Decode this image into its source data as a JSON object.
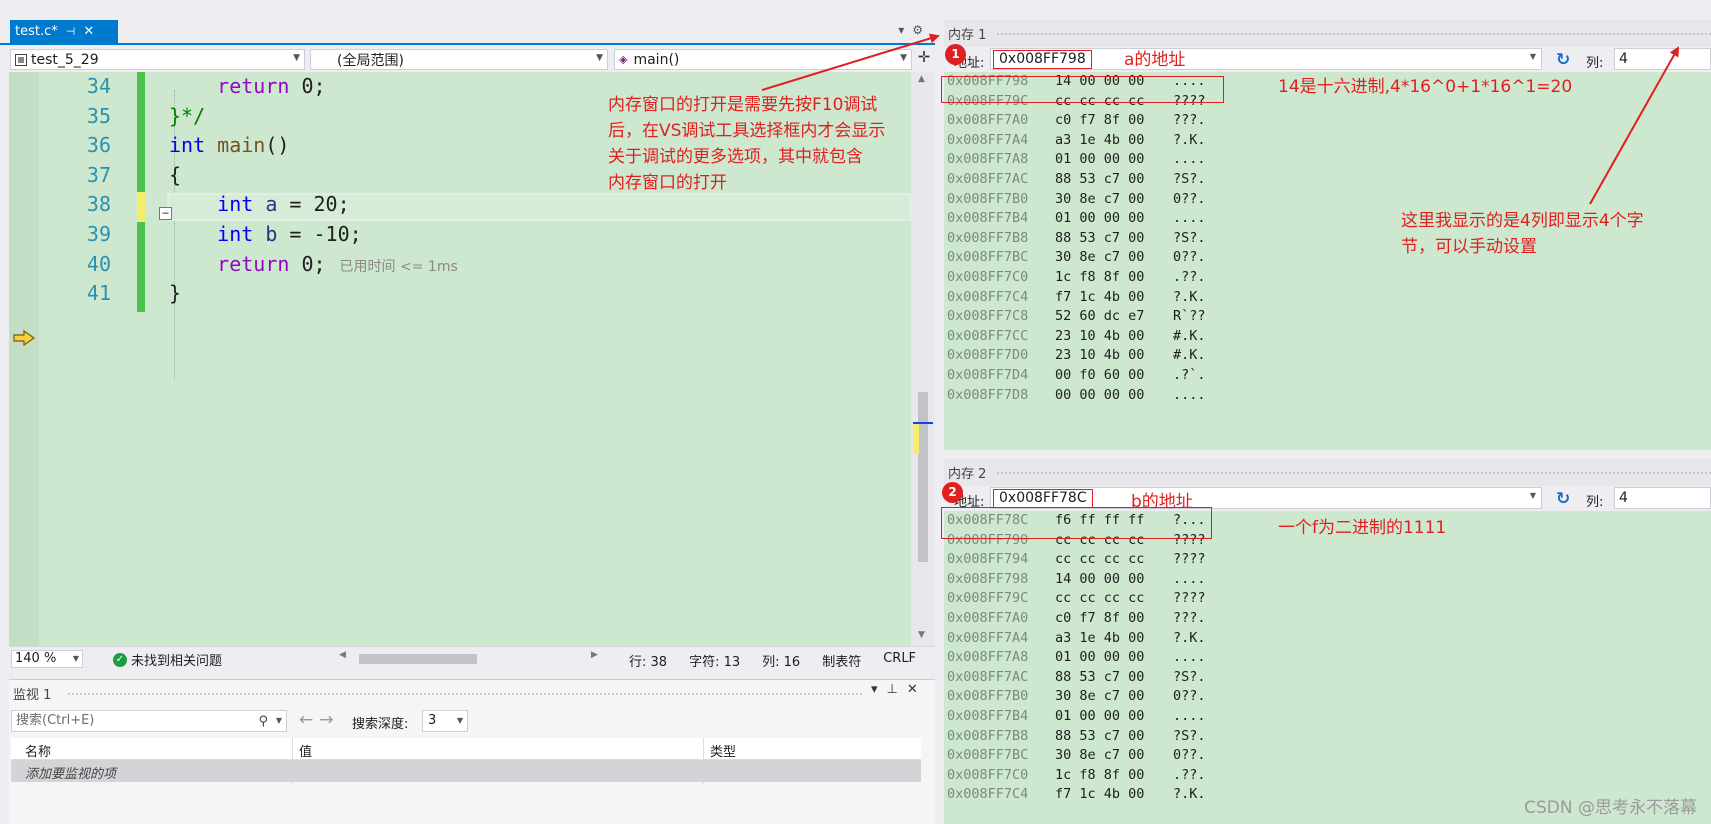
{
  "editor": {
    "tab": {
      "title": "test.c*"
    },
    "nav": {
      "project": "test_5_29",
      "scope": "(全局范围)",
      "function": "main()"
    },
    "line_numbers": [
      "34",
      "35",
      "36",
      "37",
      "38",
      "39",
      "40",
      "41"
    ],
    "elapsed": "已用时间 <= 1ms",
    "status": {
      "zoom": "140 %",
      "issues": "未找到相关问题",
      "line": "行: 38",
      "char": "字符: 13",
      "col": "列: 16",
      "tabs": "制表符",
      "eol": "CRLF"
    }
  },
  "watch": {
    "title": "监视 1",
    "search_placeholder": "搜索(Ctrl+E)",
    "depth_label": "搜索深度:",
    "depth_value": "3",
    "headers": [
      "名称",
      "值",
      "类型"
    ],
    "add_item": "添加要监视的项"
  },
  "memory1": {
    "title": "内存 1",
    "address_label": "地址:",
    "address_value": "0x008FF798",
    "columns_label": "列:",
    "columns_value": "4",
    "rows": [
      [
        "0x008FF798",
        "14 00 00 00",
        "...."
      ],
      [
        "0x008FF79C",
        "cc cc cc cc",
        "????"
      ],
      [
        "0x008FF7A0",
        "c0 f7 8f 00",
        "???."
      ],
      [
        "0x008FF7A4",
        "a3 1e 4b 00",
        "?.K."
      ],
      [
        "0x008FF7A8",
        "01 00 00 00",
        "...."
      ],
      [
        "0x008FF7AC",
        "88 53 c7 00",
        "?S?."
      ],
      [
        "0x008FF7B0",
        "30 8e c7 00",
        "0??."
      ],
      [
        "0x008FF7B4",
        "01 00 00 00",
        "...."
      ],
      [
        "0x008FF7B8",
        "88 53 c7 00",
        "?S?."
      ],
      [
        "0x008FF7BC",
        "30 8e c7 00",
        "0??."
      ],
      [
        "0x008FF7C0",
        "1c f8 8f 00",
        ".??."
      ],
      [
        "0x008FF7C4",
        "f7 1c 4b 00",
        "?.K."
      ],
      [
        "0x008FF7C8",
        "52 60 dc e7",
        "R`??"
      ],
      [
        "0x008FF7CC",
        "23 10 4b 00",
        "#.K."
      ],
      [
        "0x008FF7D0",
        "23 10 4b 00",
        "#.K."
      ],
      [
        "0x008FF7D4",
        "00 f0 60 00",
        ".?`."
      ],
      [
        "0x008FF7D8",
        "00 00 00 00",
        "...."
      ]
    ]
  },
  "memory2": {
    "title": "内存 2",
    "address_label": "地址:",
    "address_value": "0x008FF78C",
    "columns_label": "列:",
    "columns_value": "4",
    "rows": [
      [
        "0x008FF78C",
        "f6 ff ff ff",
        "?..."
      ],
      [
        "0x008FF790",
        "cc cc cc cc",
        "????"
      ],
      [
        "0x008FF794",
        "cc cc cc cc",
        "????"
      ],
      [
        "0x008FF798",
        "14 00 00 00",
        "...."
      ],
      [
        "0x008FF79C",
        "cc cc cc cc",
        "????"
      ],
      [
        "0x008FF7A0",
        "c0 f7 8f 00",
        "???."
      ],
      [
        "0x008FF7A4",
        "a3 1e 4b 00",
        "?.K."
      ],
      [
        "0x008FF7A8",
        "01 00 00 00",
        "...."
      ],
      [
        "0x008FF7AC",
        "88 53 c7 00",
        "?S?."
      ],
      [
        "0x008FF7B0",
        "30 8e c7 00",
        "0??."
      ],
      [
        "0x008FF7B4",
        "01 00 00 00",
        "...."
      ],
      [
        "0x008FF7B8",
        "88 53 c7 00",
        "?S?."
      ],
      [
        "0x008FF7BC",
        "30 8e c7 00",
        "0??."
      ],
      [
        "0x008FF7C0",
        "1c f8 8f 00",
        ".??."
      ],
      [
        "0x008FF7C4",
        "f7 1c 4b 00",
        "?.K."
      ]
    ]
  },
  "annotations": {
    "badge1": "1",
    "badge2": "2",
    "a_addr": "a的地址",
    "b_addr": "b的地址",
    "hex_note": "14是十六进制,4*16^0+1*16^1=20",
    "f_note": "一个f为二进制的1111",
    "open_note": [
      "内存窗口的打开是需要先按F10调试",
      "后，在VS调试工具选择框内才会显示",
      "关于调试的更多选项，其中就包含",
      "内存窗口的打开"
    ],
    "cols_note": [
      "这里我显示的是4列即显示4个字",
      "节，可以手动设置"
    ]
  },
  "watermark": "CSDN @思考永不落幕",
  "colors": {
    "accent": "#007acc",
    "annotation_red": "#e02020",
    "editor_bg": "#cde8cf"
  }
}
